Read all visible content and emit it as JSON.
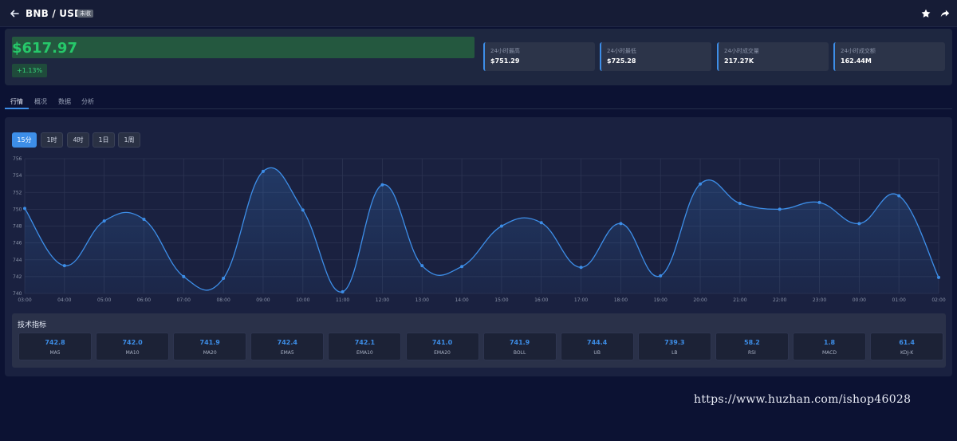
{
  "header": {
    "title": "BNB / USDT",
    "badge": "未收",
    "back_icon": "arrow-left-icon",
    "star_icon": "star-icon",
    "share_icon": "share-icon"
  },
  "price": {
    "value": "$617.97",
    "change": "+1.13%",
    "up_color": "#26c86a"
  },
  "stats": [
    {
      "label": "24小时最高",
      "value": "$751.29"
    },
    {
      "label": "24小时最低",
      "value": "$725.28"
    },
    {
      "label": "24小时成交量",
      "value": "217.27K"
    },
    {
      "label": "24小时成交额",
      "value": "162.44M"
    }
  ],
  "tabs": [
    {
      "label": "行情",
      "active": true
    },
    {
      "label": "概况",
      "active": false
    },
    {
      "label": "数据",
      "active": false
    },
    {
      "label": "分析",
      "active": false
    }
  ],
  "timeframes": [
    {
      "label": "15分",
      "active": true
    },
    {
      "label": "1时",
      "active": false
    },
    {
      "label": "4时",
      "active": false
    },
    {
      "label": "1日",
      "active": false
    },
    {
      "label": "1周",
      "active": false
    }
  ],
  "chart_data": {
    "type": "area",
    "x": [
      "03:00",
      "04:00",
      "05:00",
      "06:00",
      "07:00",
      "08:00",
      "09:00",
      "10:00",
      "11:00",
      "12:00",
      "13:00",
      "14:00",
      "15:00",
      "16:00",
      "17:00",
      "18:00",
      "19:00",
      "20:00",
      "21:00",
      "22:00",
      "23:00",
      "00:00",
      "01:00",
      "02:00"
    ],
    "y": [
      750.1,
      743.3,
      748.6,
      748.8,
      742.0,
      741.8,
      754.5,
      749.9,
      740.2,
      752.9,
      743.3,
      743.2,
      748.0,
      748.4,
      743.1,
      748.3,
      742.1,
      753.0,
      750.7,
      750.0,
      750.8,
      748.3,
      751.6,
      741.9
    ],
    "ylim": [
      740,
      756
    ],
    "yticks": [
      740,
      742,
      744,
      746,
      748,
      750,
      752,
      754,
      756
    ],
    "grid": true,
    "line_color": "#3d8ee8",
    "legend": "none"
  },
  "indicators": {
    "title": "技术指标",
    "items": [
      {
        "value": "742.8",
        "name": "MA5"
      },
      {
        "value": "742.0",
        "name": "MA10"
      },
      {
        "value": "741.9",
        "name": "MA20"
      },
      {
        "value": "742.4",
        "name": "EMA5"
      },
      {
        "value": "742.1",
        "name": "EMA10"
      },
      {
        "value": "741.0",
        "name": "EMA20"
      },
      {
        "value": "741.9",
        "name": "BOLL"
      },
      {
        "value": "744.4",
        "name": "UB"
      },
      {
        "value": "739.3",
        "name": "LB"
      },
      {
        "value": "58.2",
        "name": "RSI"
      },
      {
        "value": "1.8",
        "name": "MACD"
      },
      {
        "value": "61.4",
        "name": "KDJ-K"
      }
    ]
  },
  "watermark": "https://www.huzhan.com/ishop46028"
}
